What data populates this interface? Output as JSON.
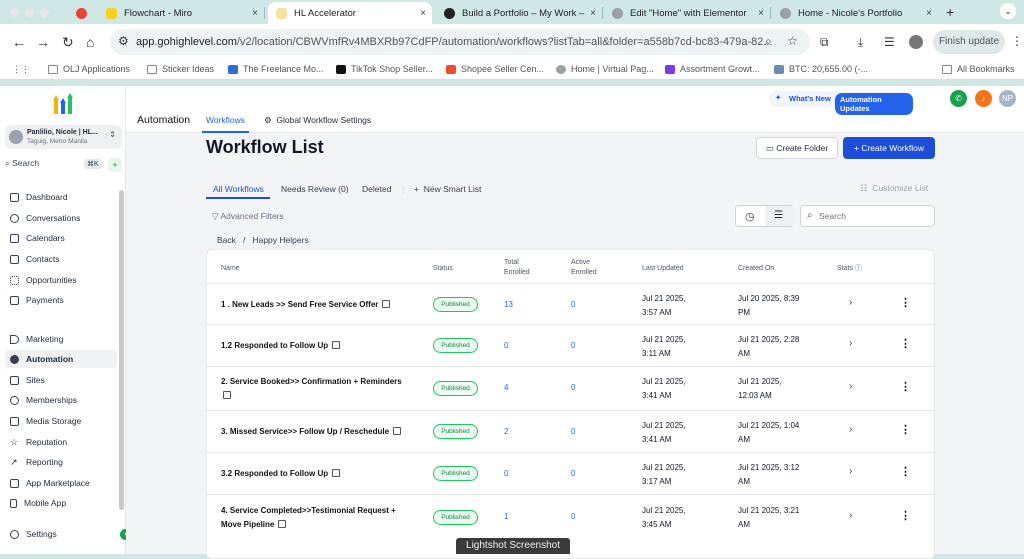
{
  "browser": {
    "tabs": [
      {
        "title": "Flowchart - Miro",
        "color": "#f7d21a",
        "active": false
      },
      {
        "title": "HL Accelerator",
        "color": "#f3e3a1",
        "active": true
      },
      {
        "title": "Build a Portfolio – My Work –",
        "color": "#222222",
        "active": false
      },
      {
        "title": "Edit \"Home\" with Elementor",
        "color": "#9aa0a6",
        "active": false
      },
      {
        "title": "Home - Nicole's Portfolio",
        "color": "#9aa0a6",
        "active": false
      }
    ],
    "url_host": "app.gohighlevel.com",
    "url_path": "/v2/location/CBWVmfRv4MBXRb97CdFP/automation/workflows?listTab=all&folder=a558b7cd-bc83-479a-82...",
    "finish_update": "Finish update",
    "bookmarks": [
      "OLJ Applications",
      "Sticker Ideas",
      "The Freelance Mo...",
      "TikTok Shop Seller...",
      "Shopee Seller Cen...",
      "Home | Virtual Pag...",
      "Assortment Growt...",
      "BTC: 20,655.00 (-..."
    ],
    "all_bookmarks": "All Bookmarks"
  },
  "sidebar": {
    "account_name": "Panlilio, Nicole | HL...",
    "account_location": "Taguig, Metro Manila",
    "search_label": "Search",
    "search_shortcut": "⌘K",
    "items": [
      {
        "label": "Dashboard",
        "active": false
      },
      {
        "label": "Conversations",
        "active": false
      },
      {
        "label": "Calendars",
        "active": false
      },
      {
        "label": "Contacts",
        "active": false
      },
      {
        "label": "Opportunities",
        "active": false
      },
      {
        "label": "Payments",
        "active": false
      },
      {
        "label": "Marketing",
        "active": false
      },
      {
        "label": "Automation",
        "active": true
      },
      {
        "label": "Sites",
        "active": false
      },
      {
        "label": "Memberships",
        "active": false
      },
      {
        "label": "Media Storage",
        "active": false
      },
      {
        "label": "Reputation",
        "active": false
      },
      {
        "label": "Reporting",
        "active": false
      },
      {
        "label": "App Marketplace",
        "active": false
      },
      {
        "label": "Mobile App",
        "active": false
      },
      {
        "label": "Settings",
        "active": false
      }
    ]
  },
  "header": {
    "section": "Automation",
    "tab_workflows": "Workflows",
    "tab_global": "Global Workflow Settings",
    "whats_new": "What's New",
    "automation_updates": "Automation Updates",
    "avatar_initials": "NP"
  },
  "page": {
    "title": "Workflow List",
    "create_folder": "Create Folder",
    "create_workflow": "Create Workflow",
    "subtabs": [
      "All Workflows",
      "Needs Review (0)",
      "Deleted"
    ],
    "new_smart_list": "New Smart List",
    "customize_list": "Customize List",
    "advanced_filters": "Advanced Filters",
    "search_placeholder": "Search",
    "breadcrumb_back": "Back",
    "breadcrumb_sep": "/",
    "breadcrumb_folder": "Happy Helpers"
  },
  "table": {
    "headers": {
      "name": "Name",
      "status": "Status",
      "total_1": "Total",
      "total_2": "Enrolled",
      "active_1": "Active",
      "active_2": "Enrolled",
      "last_updated": "Last Updated",
      "created_on": "Created On",
      "stats": "Stats"
    },
    "rows": [
      {
        "name_1": "1 . New Leads >> Send Free Service Offer",
        "name_2": "",
        "status": "Published",
        "total": "13",
        "active": "0",
        "updated_1": "Jul 21 2025,",
        "updated_2": "3:57 AM",
        "created_1": "Jul 20 2025, 8:39",
        "created_2": "PM"
      },
      {
        "name_1": "1.2 Responded to Follow Up",
        "name_2": "",
        "status": "Published",
        "total": "0",
        "active": "0",
        "updated_1": "Jul 21 2025,",
        "updated_2": "3:11 AM",
        "created_1": "Jul 21 2025, 2:28",
        "created_2": "AM"
      },
      {
        "name_1": "2. Service Booked>> Confirmation + Reminders",
        "name_2": "",
        "status": "Published",
        "total": "4",
        "active": "0",
        "updated_1": "Jul 21 2025,",
        "updated_2": "3:41 AM",
        "created_1": "Jul 21 2025,",
        "created_2": "12:03 AM"
      },
      {
        "name_1": "3. Missed Service>> Follow Up / Reschedule",
        "name_2": "",
        "status": "Published",
        "total": "2",
        "active": "0",
        "updated_1": "Jul 21 2025,",
        "updated_2": "3:41 AM",
        "created_1": "Jul 21 2025, 1:04",
        "created_2": "AM"
      },
      {
        "name_1": "3.2 Responded to Follow Up",
        "name_2": "",
        "status": "Published",
        "total": "0",
        "active": "0",
        "updated_1": "Jul 21 2025,",
        "updated_2": "3:17 AM",
        "created_1": "Jul 21 2025, 3:12",
        "created_2": "AM"
      },
      {
        "name_1": "4. Service Completed>>Testimonial Request +",
        "name_2": "Move Pipeline",
        "status": "Published",
        "total": "1",
        "active": "0",
        "updated_1": "Jul 21 2025,",
        "updated_2": "3:45 AM",
        "created_1": "Jul 21 2025, 3:21",
        "created_2": "AM"
      }
    ]
  },
  "overlay": {
    "lightshot": "Lightshot Screenshot"
  },
  "colors": {
    "accent": "#1d4ed8",
    "published": "#15803d",
    "tab_bar": "#cfe7e5"
  }
}
